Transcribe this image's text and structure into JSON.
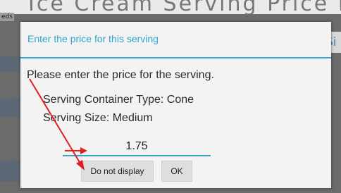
{
  "background": {
    "header_text": "Ice Cream Serving Price Editor",
    "side_label": "eds",
    "right_text": "Si"
  },
  "dialog": {
    "title": "Enter the price for this serving",
    "message": "Please enter the price for the serving.",
    "container_type": "Serving Container Type: Cone",
    "serving_size": "Serving Size: Medium",
    "price_value": "1.75",
    "buttons": {
      "do_not_display": "Do not display",
      "ok": "OK"
    }
  },
  "colors": {
    "accent": "#33a3cc",
    "annotation_arrow": "#e02020",
    "dialog_bg": "#f3f3f3"
  },
  "icons": {
    "annotation": "red-arrow-icon"
  }
}
